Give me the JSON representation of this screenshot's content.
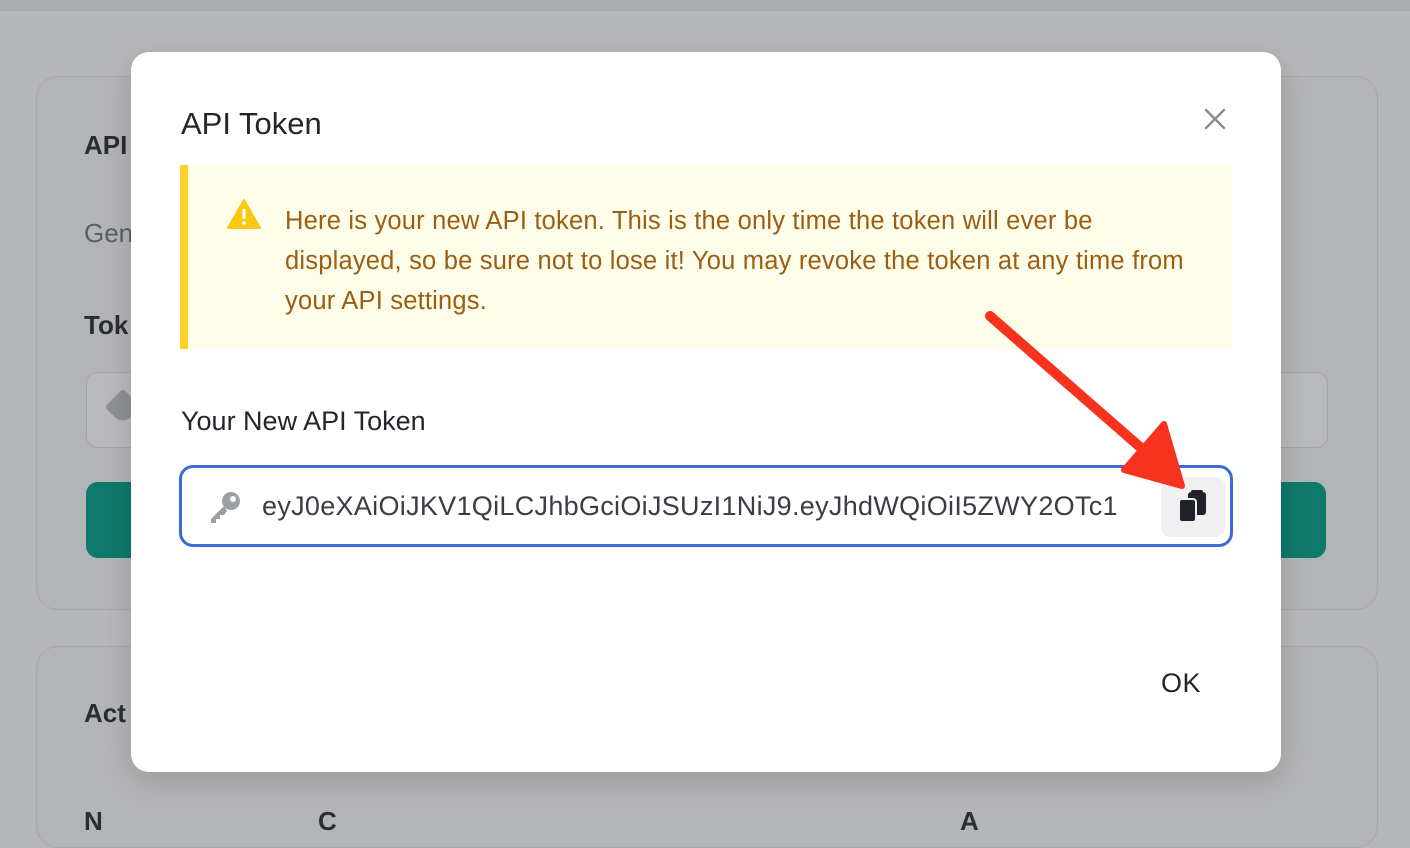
{
  "background": {
    "card1_title": "API",
    "card1_subtitle": "Gen",
    "card1_field_label": "Tok",
    "card2_title": "Act",
    "table_headers": [
      "N",
      "C",
      "A"
    ]
  },
  "modal": {
    "title": "API Token",
    "close_icon": "close-icon",
    "alert": {
      "icon": "warning-icon",
      "text": "Here is your new API token. This is the only time the token will ever be displayed, so be sure not to lose it! You may revoke the token at any time from your API settings.",
      "color": "#9b5e14",
      "accent": "#fbd12a"
    },
    "token_field": {
      "label": "Your New API Token",
      "icon": "key-icon",
      "value": "eyJ0eXAiOiJKV1QiLCJhbGciOiJSUzI1NiJ9.eyJhdWQiOiI5ZWY2OTc1",
      "copy_icon": "clipboard-copy-icon"
    },
    "ok_label": "OK"
  },
  "annotation": {
    "arrow_color": "#f7321e"
  }
}
